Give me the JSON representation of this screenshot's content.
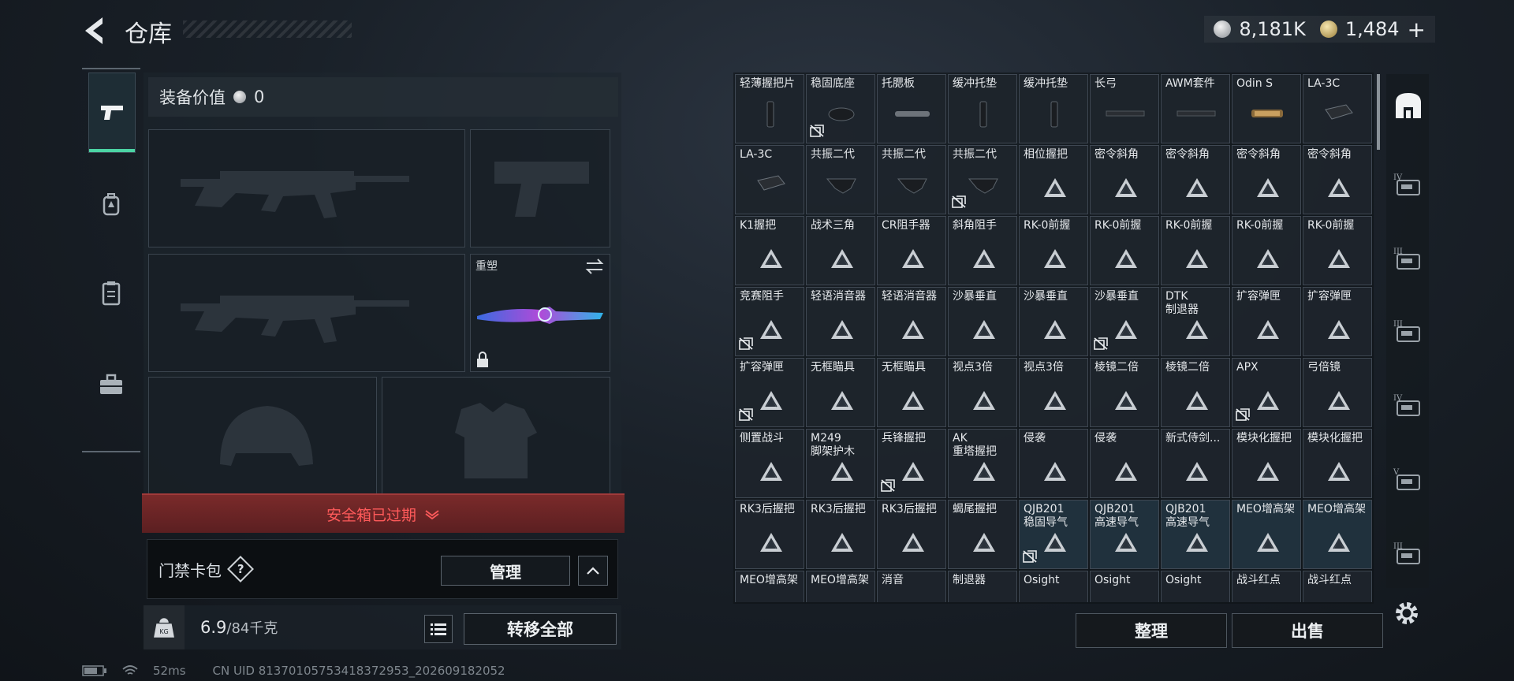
{
  "header": {
    "title": "仓库",
    "silver": "8,181K",
    "gold": "1,484",
    "gold_add": "+"
  },
  "equip": {
    "value_label": "装备价值",
    "value": "0",
    "rebuild_label": "重塑"
  },
  "safebox": {
    "expired_label": "安全箱已过期"
  },
  "keycard": {
    "label": "门禁卡包",
    "help": "?",
    "manage_label": "管理"
  },
  "weight": {
    "current": "6.9",
    "max": "/84千克",
    "transfer_all_label": "转移全部"
  },
  "status": {
    "ping": "52ms",
    "uid": "CN UID 81370105753418372953_202609182052"
  },
  "grid": {
    "rows": [
      [
        {
          "name": "轻薄握把片",
          "thumb": "mag",
          "nodrop": false
        },
        {
          "name": "稳固底座",
          "thumb": "disc",
          "nodrop": true
        },
        {
          "name": "托腮板",
          "thumb": "bar",
          "nodrop": false
        },
        {
          "name": "缓冲托垫",
          "thumb": "mag",
          "nodrop": false
        },
        {
          "name": "缓冲托垫",
          "thumb": "mag",
          "nodrop": false
        },
        {
          "name": "长弓",
          "thumb": "rail",
          "nodrop": false
        },
        {
          "name": "AWM套件",
          "thumb": "rail",
          "nodrop": false
        },
        {
          "name": "Odin S",
          "thumb": "scope",
          "nodrop": false
        },
        {
          "name": "LA-3C",
          "thumb": "box",
          "nodrop": false
        }
      ],
      [
        {
          "name": "LA-3C",
          "thumb": "box",
          "nodrop": false
        },
        {
          "name": "共振二代",
          "thumb": "grip",
          "nodrop": false
        },
        {
          "name": "共振二代",
          "thumb": "grip",
          "nodrop": false
        },
        {
          "name": "共振二代",
          "thumb": "grip",
          "nodrop": true
        },
        {
          "name": "相位握把",
          "thumb": "",
          "nodrop": false
        },
        {
          "name": "密令斜角",
          "thumb": "",
          "nodrop": false
        },
        {
          "name": "密令斜角",
          "thumb": "",
          "nodrop": false
        },
        {
          "name": "密令斜角",
          "thumb": "",
          "nodrop": false
        },
        {
          "name": "密令斜角",
          "thumb": "",
          "nodrop": false
        }
      ],
      [
        {
          "name": "K1握把",
          "thumb": "",
          "nodrop": false
        },
        {
          "name": "战术三角",
          "thumb": "",
          "nodrop": false
        },
        {
          "name": "CR阻手器",
          "thumb": "",
          "nodrop": false
        },
        {
          "name": "斜角阻手",
          "thumb": "",
          "nodrop": false
        },
        {
          "name": "RK-0前握",
          "thumb": "",
          "nodrop": false
        },
        {
          "name": "RK-0前握",
          "thumb": "",
          "nodrop": false
        },
        {
          "name": "RK-0前握",
          "thumb": "",
          "nodrop": false
        },
        {
          "name": "RK-0前握",
          "thumb": "",
          "nodrop": false
        },
        {
          "name": "RK-0前握",
          "thumb": "",
          "nodrop": false
        }
      ],
      [
        {
          "name": "竞赛阻手",
          "thumb": "",
          "nodrop": true
        },
        {
          "name": "轻语消音器",
          "thumb": "",
          "nodrop": false
        },
        {
          "name": "轻语消音器",
          "thumb": "",
          "nodrop": false
        },
        {
          "name": "沙暴垂直",
          "thumb": "",
          "nodrop": false
        },
        {
          "name": "沙暴垂直",
          "thumb": "",
          "nodrop": false
        },
        {
          "name": "沙暴垂直",
          "thumb": "",
          "nodrop": true
        },
        {
          "name": "DTK\n制退器",
          "thumb": "",
          "nodrop": false
        },
        {
          "name": "扩容弹匣",
          "thumb": "",
          "nodrop": false
        },
        {
          "name": "扩容弹匣",
          "thumb": "",
          "nodrop": false
        }
      ],
      [
        {
          "name": "扩容弹匣",
          "thumb": "",
          "nodrop": true
        },
        {
          "name": "无框瞄具",
          "thumb": "",
          "nodrop": false
        },
        {
          "name": "无框瞄具",
          "thumb": "",
          "nodrop": false
        },
        {
          "name": "视点3倍",
          "thumb": "",
          "nodrop": false
        },
        {
          "name": "视点3倍",
          "thumb": "",
          "nodrop": false
        },
        {
          "name": "棱镜二倍",
          "thumb": "",
          "nodrop": false
        },
        {
          "name": "棱镜二倍",
          "thumb": "",
          "nodrop": false
        },
        {
          "name": "APX",
          "thumb": "",
          "nodrop": true
        },
        {
          "name": "弓倍镜",
          "thumb": "",
          "nodrop": false
        }
      ],
      [
        {
          "name": "侧置战斗",
          "thumb": "",
          "nodrop": false
        },
        {
          "name": "M249\n脚架护木",
          "thumb": "",
          "nodrop": false
        },
        {
          "name": "兵锋握把",
          "thumb": "",
          "nodrop": true
        },
        {
          "name": "AK\n重塔握把",
          "thumb": "",
          "nodrop": false
        },
        {
          "name": "侵袭",
          "thumb": "",
          "nodrop": false
        },
        {
          "name": "侵袭",
          "thumb": "",
          "nodrop": false
        },
        {
          "name": "新式侍剑...",
          "thumb": "",
          "nodrop": false
        },
        {
          "name": "模块化握把",
          "thumb": "",
          "nodrop": false
        },
        {
          "name": "模块化握把",
          "thumb": "",
          "nodrop": false
        }
      ],
      [
        {
          "name": "RK3后握把",
          "thumb": "",
          "nodrop": false
        },
        {
          "name": "RK3后握把",
          "thumb": "",
          "nodrop": false
        },
        {
          "name": "RK3后握把",
          "thumb": "",
          "nodrop": false
        },
        {
          "name": "蝎尾握把",
          "thumb": "",
          "nodrop": false
        },
        {
          "name": "QJB201\n稳固导气",
          "thumb": "",
          "nodrop": true,
          "blue": true
        },
        {
          "name": "QJB201\n高速导气",
          "thumb": "",
          "nodrop": false,
          "blue": true
        },
        {
          "name": "QJB201\n高速导气",
          "thumb": "",
          "nodrop": false,
          "blue": true
        },
        {
          "name": "MEO增高架",
          "thumb": "",
          "nodrop": false,
          "blue": true
        },
        {
          "name": "MEO增高架",
          "thumb": "",
          "nodrop": false,
          "blue": true
        }
      ],
      [
        {
          "name": "MEO增高架",
          "thumb": "",
          "nodrop": false
        },
        {
          "name": "MEO增高架",
          "thumb": "",
          "nodrop": false
        },
        {
          "name": "消音",
          "thumb": "",
          "nodrop": false
        },
        {
          "name": "制退器",
          "thumb": "",
          "nodrop": false
        },
        {
          "name": "Osight",
          "thumb": "",
          "nodrop": false
        },
        {
          "name": "Osight",
          "thumb": "",
          "nodrop": false
        },
        {
          "name": "Osight",
          "thumb": "",
          "nodrop": false
        },
        {
          "name": "战斗红点",
          "thumb": "",
          "nodrop": false
        },
        {
          "name": "战斗红点",
          "thumb": "",
          "nodrop": false
        }
      ]
    ]
  },
  "actions": {
    "sort_label": "整理",
    "sell_label": "出售"
  },
  "right_tabs": [
    {
      "icon": "backpack-icon"
    },
    {
      "icon": "tier4-plus-icon",
      "tier": "IV"
    },
    {
      "icon": "tier3-rifle-icon",
      "tier": "III"
    },
    {
      "icon": "tier3-vest-icon",
      "tier": "III"
    },
    {
      "icon": "tier4-folder-icon",
      "tier": "IV"
    },
    {
      "icon": "tier5-gear-icon",
      "tier": "V"
    },
    {
      "icon": "tier3-card-icon",
      "tier": "III"
    }
  ],
  "colors": {
    "accent": "#4cd4a4",
    "expired": "#ff5a5a",
    "rebuild_card": "#7a4ad0"
  }
}
